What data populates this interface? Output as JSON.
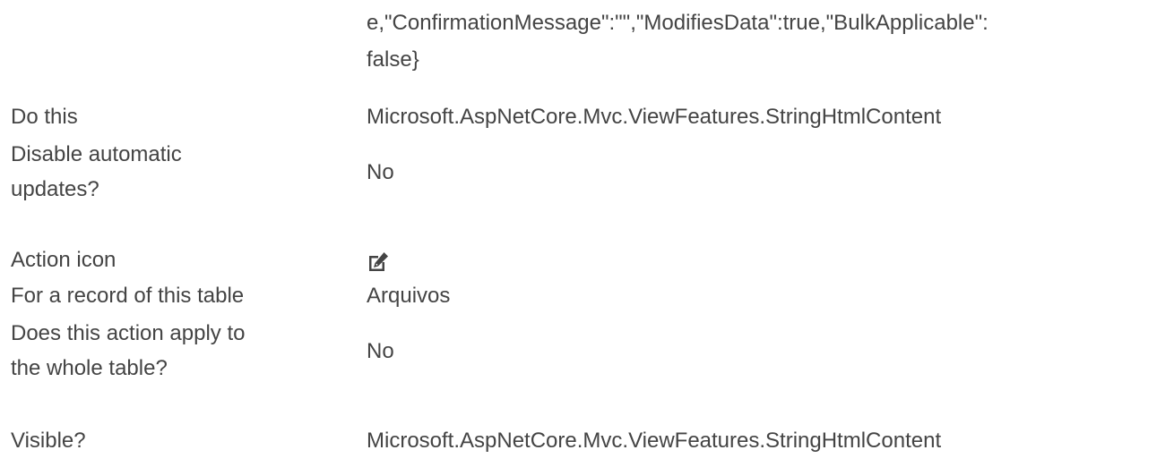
{
  "continuation": {
    "line1": "e,\"ConfirmationMessage\":\"\",\"ModifiesData\":true,\"BulkApplicable\":",
    "line2": "false}"
  },
  "rows": [
    {
      "label": "Do this",
      "value": "Microsoft.AspNetCore.Mvc.ViewFeatures.StringHtmlContent"
    },
    {
      "label_line1": "Disable automatic",
      "label_line2": "updates?",
      "value": "No"
    },
    {
      "label": "Action icon",
      "icon": "edit-icon"
    },
    {
      "label": "For a record of this table",
      "value": "Arquivos"
    },
    {
      "label_line1": "Does this action apply to",
      "label_line2": "the whole table?",
      "value": "No"
    },
    {
      "label": "Visible?",
      "value": "Microsoft.AspNetCore.Mvc.ViewFeatures.StringHtmlContent"
    }
  ],
  "colors": {
    "text": "#444444",
    "background": "#ffffff"
  }
}
